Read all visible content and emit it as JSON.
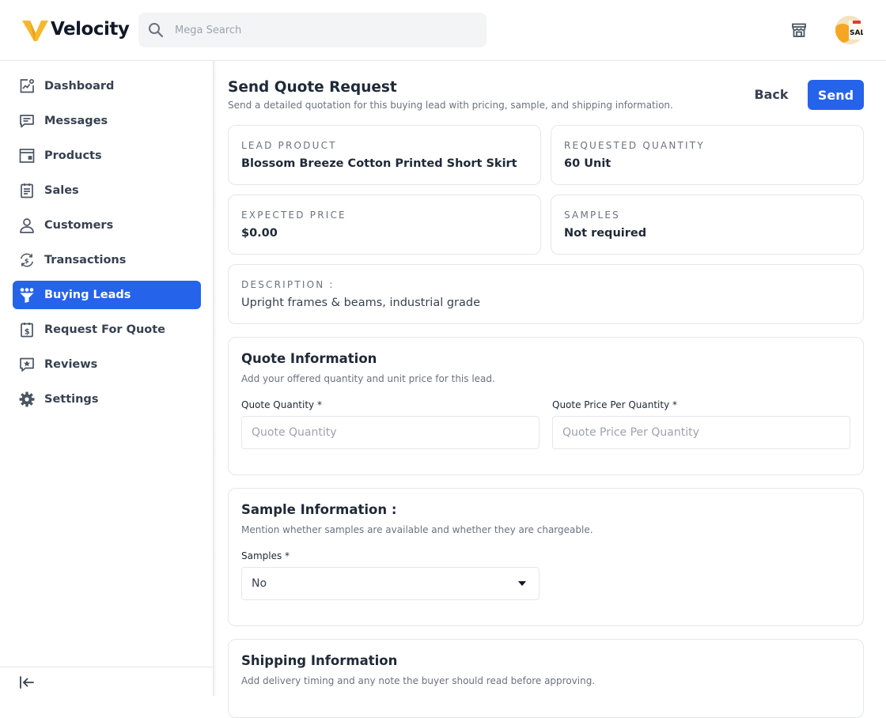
{
  "app": {
    "name": "Velocity",
    "colors": {
      "primary": "#2563eb",
      "logo_yellow": "#f5b82e"
    }
  },
  "topbar": {
    "search": {
      "placeholder": "Mega Search",
      "value": ""
    },
    "store_icon": "store-icon",
    "avatar_icon": "avatar"
  },
  "sidebar": {
    "items": [
      {
        "label": "Dashboard",
        "icon": "dashboard-icon"
      },
      {
        "label": "Messages",
        "icon": "messages-icon"
      },
      {
        "label": "Products",
        "icon": "products-icon"
      },
      {
        "label": "Sales",
        "icon": "sales-icon"
      },
      {
        "label": "Customers",
        "icon": "customers-icon"
      },
      {
        "label": "Transactions",
        "icon": "transactions-icon"
      },
      {
        "label": "Buying Leads",
        "icon": "buying-leads-icon",
        "active": true
      },
      {
        "label": "Request For Quote",
        "icon": "request-for-quote-icon"
      },
      {
        "label": "Reviews",
        "icon": "reviews-icon"
      },
      {
        "label": "Settings",
        "icon": "settings-icon"
      }
    ],
    "collapse_icon": "collapse-sidebar-icon"
  },
  "page": {
    "title": "Send Quote Request",
    "subtitle": "Send a detailed quotation for this buying lead with pricing, sample, and shipping information.",
    "back_label": "Back",
    "send_label": "Send"
  },
  "lead": {
    "product_label": "LEAD PRODUCT",
    "product_value": "Blossom Breeze Cotton Printed Short Skirt",
    "quantity_label": "REQUESTED QUANTITY",
    "quantity_value": "60 Unit",
    "price_label": "EXPECTED PRICE",
    "price_value": "$0.00",
    "samples_label": "SAMPLES",
    "samples_value": "Not required",
    "description_label": "DESCRIPTION :",
    "description_value": "Upright frames & beams, industrial grade"
  },
  "quote_info": {
    "title": "Quote Information",
    "subtitle": "Add your offered quantity and unit price for this lead.",
    "quantity_label": "Quote Quantity *",
    "quantity_placeholder": "Quote Quantity",
    "price_label": "Quote Price Per Quantity *",
    "price_placeholder": "Quote Price Per Quantity"
  },
  "sample_info": {
    "title": "Sample Information :",
    "subtitle": "Mention whether samples are available and whether they are chargeable.",
    "samples_label": "Samples *",
    "samples_value": "No"
  },
  "shipping_info": {
    "title": "Shipping Information",
    "subtitle": "Add delivery timing and any note the buyer should read before approving."
  }
}
